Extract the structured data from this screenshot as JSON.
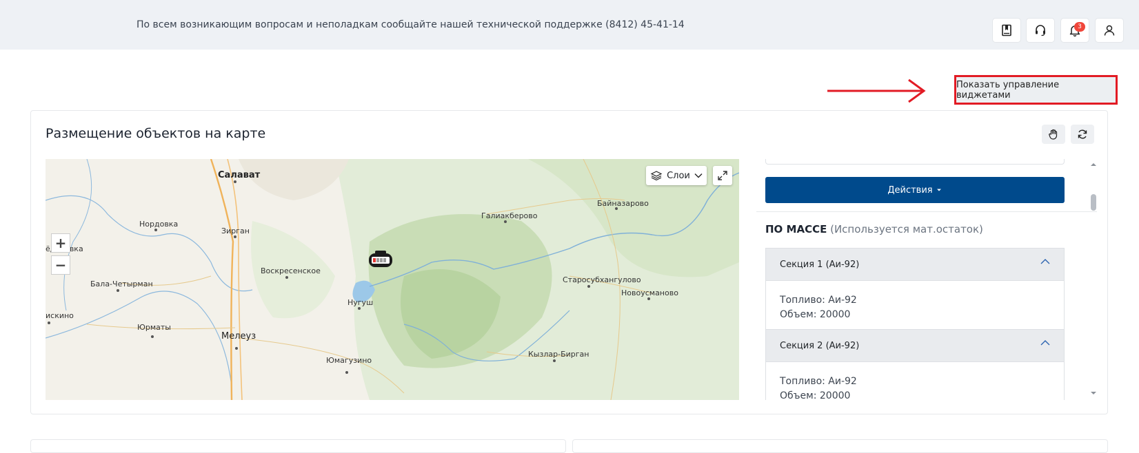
{
  "topbar": {
    "notice": "По всем возникающим вопросам и неполадкам сообщайте нашей технической поддержке (8412) 45-41-14",
    "notifications_count": "3",
    "icons": [
      "book-icon",
      "headset-icon",
      "bell-icon",
      "user-icon"
    ]
  },
  "widgets": {
    "toggle_label": "Показать управление виджетами",
    "highlight_color": "#e21b24"
  },
  "card": {
    "title": "Размещение объектов на карте"
  },
  "map": {
    "layers_label": "Слои",
    "zoom_in": "+",
    "zoom_out": "−",
    "labels": {
      "salavat": "Салават",
      "nordovka": "Нордовка",
      "zirgan": "Зирган",
      "edorovka": "ёдоровка",
      "voskresenskoe": "Воскресенское",
      "bala": "Бала-Четырман",
      "iskino": "искино",
      "yurmaty": "Юрматы",
      "meleuz": "Мелеуз",
      "nugush": "Нугуш",
      "yumaguzino": "Юмагузино",
      "galiakberovo": "Галиакберово",
      "baynazarovo": "Байназарово",
      "starosubkhangulovo": "Старосубхангулово",
      "novousmanovo": "Новоусманово",
      "kyzlar": "Кызлар-Бирган"
    }
  },
  "panel": {
    "actions_label": "Действия",
    "mass_title": "ПО МАССЕ",
    "mass_note": "(Используется мат.остаток)",
    "sections": [
      {
        "title": "Секция 1 (Аи-92)",
        "fuel": "Топливо: Аи-92",
        "volume": "Объем: 20000"
      },
      {
        "title": "Секция 2 (Аи-92)",
        "fuel": "Топливо: Аи-92",
        "volume": "Объем: 20000"
      }
    ]
  },
  "colors": {
    "primary": "#004a8c",
    "badge": "#f0463a",
    "topbar_bg": "#eef1f5"
  }
}
